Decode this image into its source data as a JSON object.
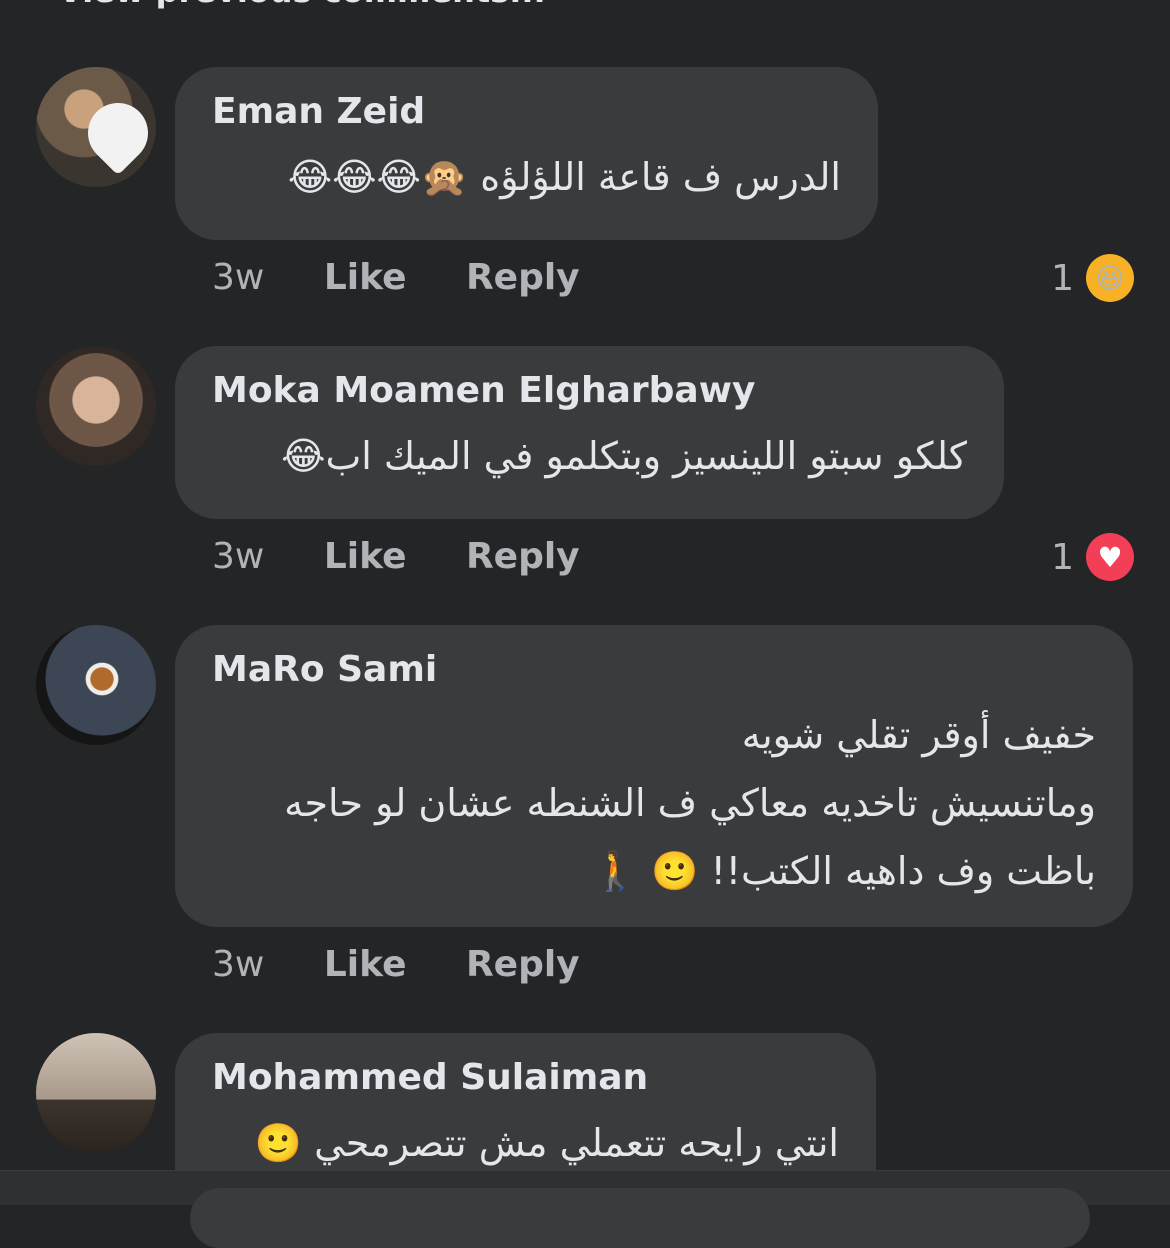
{
  "top": {
    "partial_text": "View previous comments..."
  },
  "comments": [
    {
      "name": "Eman Zeid",
      "lines": [
        "الدرس ف قاعة اللؤلؤه 🙊😂😂😂"
      ],
      "time": "3w",
      "like": "Like",
      "reply": "Reply",
      "reaction_count": "1",
      "reaction": "haha-icon",
      "reaction_glyph": "😆"
    },
    {
      "name": "Moka Moamen Elgharbawy",
      "lines": [
        "كلكو سبتو اللينسيز وبتكلمو في الميك اب😂"
      ],
      "time": "3w",
      "like": "Like",
      "reply": "Reply",
      "reaction_count": "1",
      "reaction": "love-icon",
      "reaction_glyph": "♥"
    },
    {
      "name": "MaRo Sami",
      "lines": [
        "خفيف أوقر تقلي شويه",
        "وماتنسيش تاخديه معاكي ف الشنطه عشان لو حاجه",
        "باظت وف داهيه الكتب!! 🙂 🚶"
      ],
      "time": "3w",
      "like": "Like",
      "reply": "Reply"
    },
    {
      "name": "Mohammed Sulaiman",
      "lines": [
        "انتي رايحه تتعملي مش تتصرمحي 🙂"
      ]
    }
  ],
  "colors": {
    "background": "#242526",
    "bubble": "#3a3b3c",
    "meta": "#b0b3b8",
    "haha": "#f7b125",
    "love": "#f33e58"
  }
}
